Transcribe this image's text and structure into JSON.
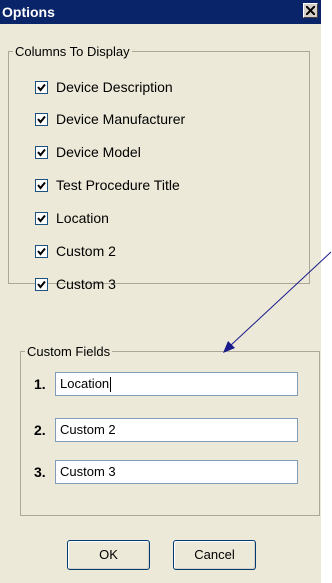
{
  "window": {
    "title": "Options",
    "close_glyph": "close-icon"
  },
  "columns_group": {
    "legend": "Columns To Display",
    "items": [
      {
        "label": "Device Description",
        "checked": true
      },
      {
        "label": "Device Manufacturer",
        "checked": true
      },
      {
        "label": "Device Model",
        "checked": true
      },
      {
        "label": "Test Procedure Title",
        "checked": true
      },
      {
        "label": "Location",
        "checked": true
      },
      {
        "label": "Custom 2",
        "checked": true
      },
      {
        "label": "Custom 3",
        "checked": true
      }
    ]
  },
  "custom_fields_group": {
    "legend": "Custom Fields",
    "fields": [
      {
        "number": "1.",
        "value": "Location"
      },
      {
        "number": "2.",
        "value": "Custom 2"
      },
      {
        "number": "3.",
        "value": "Custom 3"
      }
    ]
  },
  "buttons": {
    "ok_label": "OK",
    "cancel_label": "Cancel"
  },
  "colors": {
    "titlebar": "#0a246a",
    "dialog_bg": "#ece9d8",
    "annotation_arrow": "#1a1a8c"
  }
}
